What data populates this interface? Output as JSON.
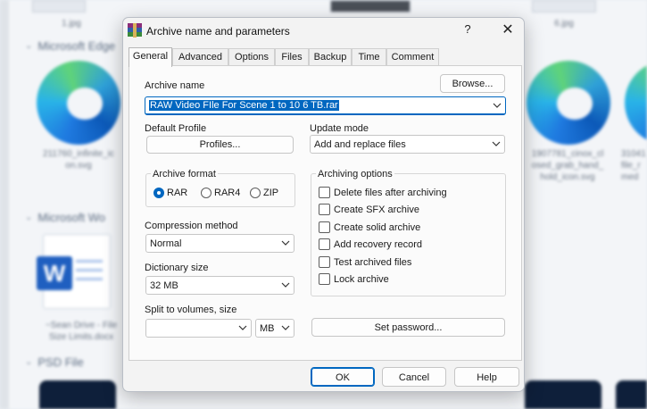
{
  "background": {
    "top_captions": [
      "1.jpg",
      "6.jpg"
    ],
    "groups": [
      "Microsoft Edge",
      "Microsoft Wo",
      "PSD File"
    ],
    "captions": {
      "edge_left": "211760_infinite_ic\non.svg",
      "edge_right_a": "1907781_cinox_cl\nosed_grab_hand_\nhold_icon.svg",
      "edge_right_b": "31041\nfile_r\nmed",
      "word": "~Sean Drive - File\nSize Limits.docx"
    }
  },
  "dialog": {
    "title": "Archive name and parameters",
    "help": "?",
    "close": "✕",
    "tabs": [
      "General",
      "Advanced",
      "Options",
      "Files",
      "Backup",
      "Time",
      "Comment"
    ],
    "active_tab": "General",
    "archive_name_label": "Archive name",
    "browse_label": "Browse...",
    "archive_name_value": "RAW Video FIle For Scene 1 to 10 6 TB.rar",
    "default_profile_label": "Default Profile",
    "profiles_label": "Profiles...",
    "update_mode_label": "Update mode",
    "update_mode_value": "Add and replace files",
    "archive_format_label": "Archive format",
    "formats": [
      "RAR",
      "RAR4",
      "ZIP"
    ],
    "selected_format": "RAR",
    "compression_method_label": "Compression method",
    "compression_method_value": "Normal",
    "dictionary_size_label": "Dictionary size",
    "dictionary_size_value": "32 MB",
    "split_label": "Split to volumes, size",
    "split_value": "",
    "split_unit": "MB",
    "archiving_options_label": "Archiving options",
    "options": [
      {
        "label": "Delete files after archiving",
        "checked": false
      },
      {
        "label": "Create SFX archive",
        "checked": false
      },
      {
        "label": "Create solid archive",
        "checked": false
      },
      {
        "label": "Add recovery record",
        "checked": false
      },
      {
        "label": "Test archived files",
        "checked": false
      },
      {
        "label": "Lock archive",
        "checked": false
      }
    ],
    "set_password_label": "Set password...",
    "ok_label": "OK",
    "cancel_label": "Cancel",
    "help_label": "Help"
  }
}
